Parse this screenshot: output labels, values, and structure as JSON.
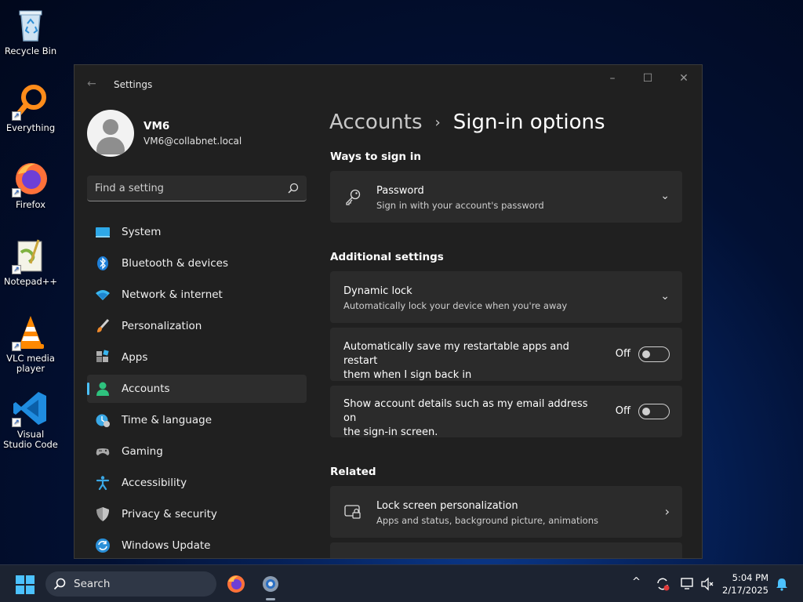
{
  "desktop": {
    "icons": [
      {
        "label": "Recycle Bin"
      },
      {
        "label": "Everything"
      },
      {
        "label": "Firefox"
      },
      {
        "label": "Notepad++"
      },
      {
        "label": "VLC media player"
      },
      {
        "label": "Visual Studio Code"
      }
    ]
  },
  "window": {
    "title": "Settings",
    "profile": {
      "name": "VM6",
      "email": "VM6@collabnet.local"
    },
    "search_placeholder": "Find a setting",
    "nav": [
      {
        "label": "System",
        "icon": "system-icon"
      },
      {
        "label": "Bluetooth & devices",
        "icon": "bluetooth-icon"
      },
      {
        "label": "Network & internet",
        "icon": "network-icon"
      },
      {
        "label": "Personalization",
        "icon": "brush-icon"
      },
      {
        "label": "Apps",
        "icon": "apps-icon"
      },
      {
        "label": "Accounts",
        "icon": "accounts-icon",
        "active": true
      },
      {
        "label": "Time & language",
        "icon": "clock-icon"
      },
      {
        "label": "Gaming",
        "icon": "gamepad-icon"
      },
      {
        "label": "Accessibility",
        "icon": "accessibility-icon"
      },
      {
        "label": "Privacy & security",
        "icon": "shield-icon"
      },
      {
        "label": "Windows Update",
        "icon": "update-icon"
      }
    ]
  },
  "main": {
    "breadcrumb": {
      "parent": "Accounts",
      "separator": "›",
      "current": "Sign-in options"
    },
    "ways_title": "Ways to sign in",
    "password": {
      "title": "Password",
      "subtitle": "Sign in with your account's password"
    },
    "additional_title": "Additional settings",
    "dynamic_lock": {
      "title": "Dynamic lock",
      "subtitle": "Automatically lock your device when you're away"
    },
    "restart_apps": {
      "line1": "Automatically save my restartable apps and restart",
      "line2": "them when I sign back in",
      "state": "Off"
    },
    "account_details": {
      "line1": "Show account details such as my email address on",
      "line2": "the sign-in screen.",
      "state": "Off"
    },
    "related_title": "Related",
    "lock_screen": {
      "title": "Lock screen personalization",
      "subtitle": "Apps and status, background picture, animations"
    }
  },
  "taskbar": {
    "search_label": "Search",
    "time": "5:04 PM",
    "date": "2/17/2025"
  },
  "colors": {
    "accent": "#4cc2ff",
    "window_bg": "#202020",
    "card_bg": "#2b2b2b"
  }
}
